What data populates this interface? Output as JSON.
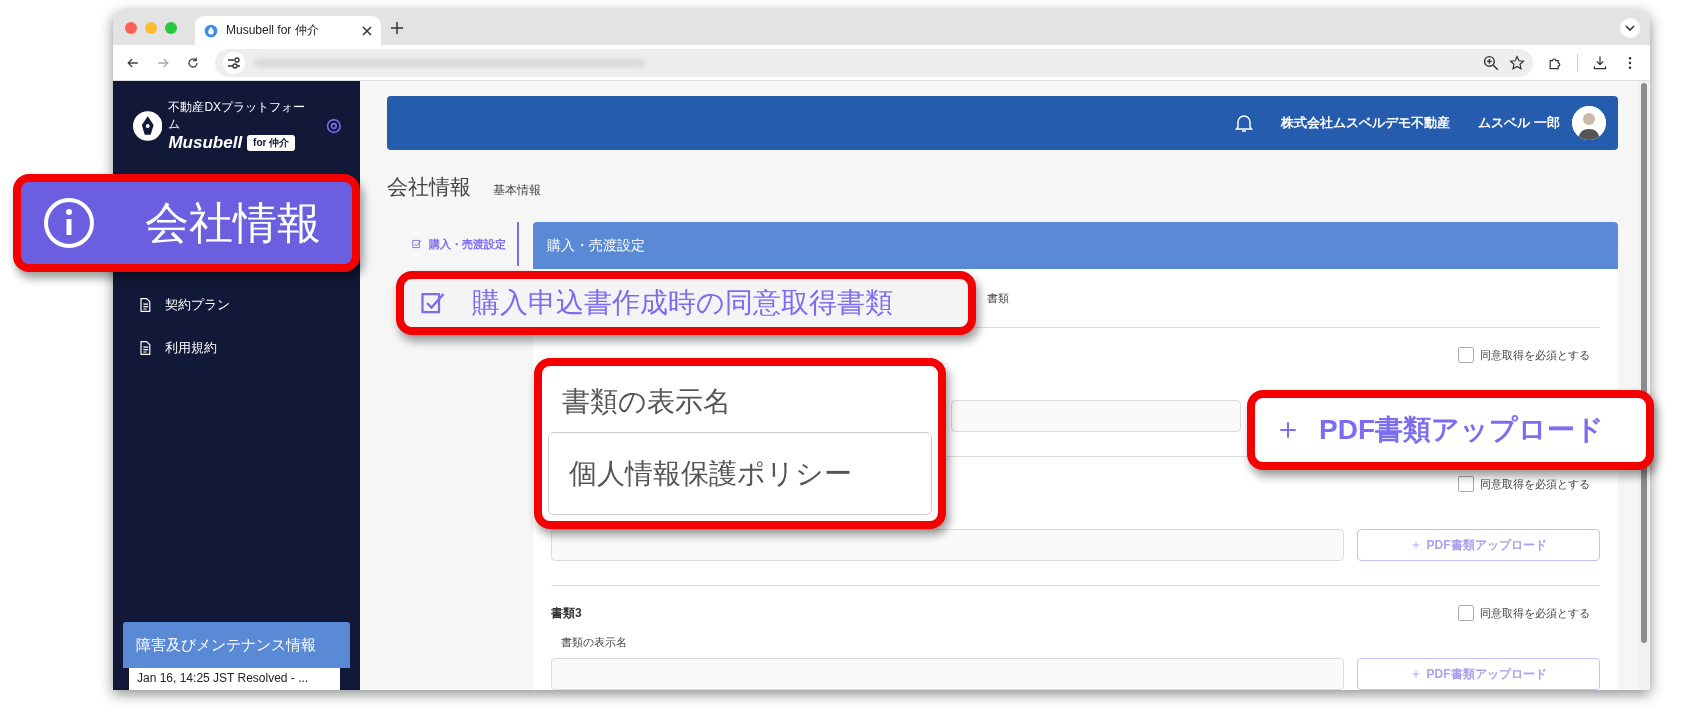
{
  "browser": {
    "tab_title": "Musubell for 仲介"
  },
  "sidebar": {
    "logo_tagline": "不動産DXプラットフォーム",
    "logo_name": "Musubell",
    "logo_badge": "for 仲介",
    "items": [
      {
        "label": "契約プラン"
      },
      {
        "label": "利用規約"
      }
    ],
    "status_panel": {
      "title": "障害及びメンテナンス情報",
      "entries": [
        "Jan 16, 14:25 JST Resolved - ..."
      ]
    }
  },
  "header": {
    "company": "株式会社ムスベルデモ不動産",
    "user": "ムスベル 一郎"
  },
  "page": {
    "title": "会社情報",
    "subtitle": "基本情報",
    "side_tabs": [
      {
        "label": "購入・売渡設定",
        "selected": true
      }
    ]
  },
  "card": {
    "title": "購入・売渡設定",
    "heading_visible": "書類",
    "documents": [
      {
        "consent_label": "同意取得を必須とする",
        "checked": false
      },
      {
        "consent_label": "同意取得を必須とする",
        "checked": false,
        "upload": "PDF書類アップロード"
      },
      {
        "label": "書類3",
        "consent_label": "同意取得を必須とする",
        "checked": false,
        "field_label": "書類の表示名",
        "upload": "PDF書類アップロード"
      }
    ]
  },
  "callouts": [
    {
      "kind": "nav-item",
      "text": "会社情報"
    },
    {
      "kind": "heading",
      "text": "購入申込書作成時の同意取得書類"
    },
    {
      "kind": "field",
      "label": "書類の表示名",
      "value": "個人情報保護ポリシー"
    },
    {
      "kind": "button",
      "text": "PDF書類アップロード"
    }
  ]
}
